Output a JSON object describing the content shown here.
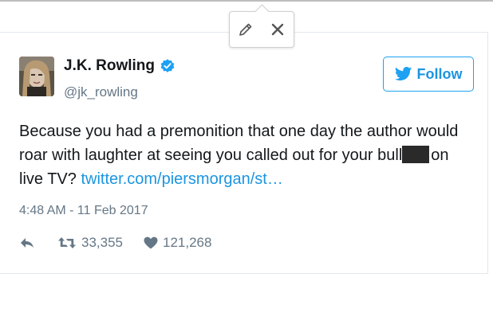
{
  "popover": {
    "edit_icon": "pencil-icon",
    "close_icon": "close-icon"
  },
  "author": {
    "name": "J.K. Rowling",
    "handle": "@jk_rowling",
    "verified_icon": "verified-badge-icon"
  },
  "follow_button": {
    "label": "Follow",
    "icon": "twitter-bird-icon"
  },
  "tweet": {
    "text_part1": "Because you had a premonition that one day the author would roar with laughter at seeing you called out for your bull",
    "text_part2": "on live TV?",
    "link_text": "twitter.com/piersmorgan/st…",
    "timestamp": "4:48 AM - 11 Feb 2017"
  },
  "stats": {
    "reply_icon": "reply-icon",
    "retweet_icon": "retweet-icon",
    "retweets": "33,355",
    "like_icon": "heart-icon",
    "likes": "121,268"
  },
  "colors": {
    "accent": "#1da1f2",
    "link": "#1b95e0",
    "text": "#14171a",
    "muted": "#657786"
  }
}
